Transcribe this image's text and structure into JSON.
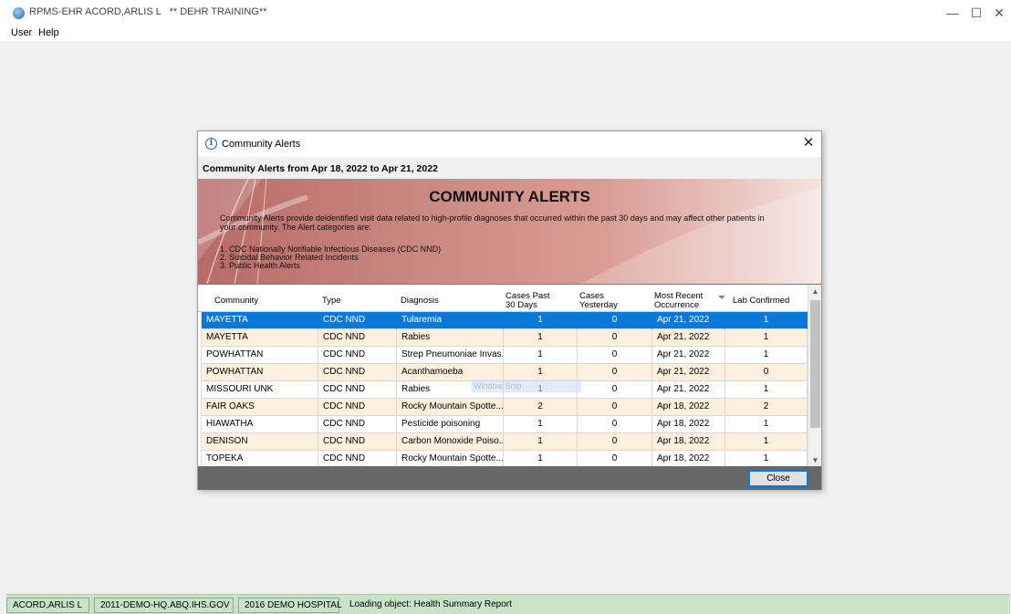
{
  "app": {
    "title": "RPMS-EHR ACORD,ARLIS L   ** DEHR TRAINING**",
    "menu": [
      "User",
      "Help"
    ],
    "window_controls": {
      "minimize": "—",
      "maximize": "☐",
      "close": "✕"
    }
  },
  "dialog": {
    "title": "Community Alerts",
    "close_glyph": "✕",
    "info_glyph": "i",
    "subtitle": "Community Alerts from Apr 18, 2022 to Apr 21, 2022",
    "banner": {
      "heading": "COMMUNITY ALERTS",
      "description": "Community Alerts provide deidentified visit data related to high-profile diagnoses that occurred within the past 30 days and may affect other patients in your community.  The Alert categories are:",
      "categories": [
        "1. CDC Nationally Notifiable Infectious Diseases (CDC NND)",
        "2. Suicidal Behavior Related Incidents",
        "3. Public Health Alerts"
      ]
    },
    "grid": {
      "headers": {
        "community": "Community",
        "type": "Type",
        "diagnosis": "Diagnosis",
        "cases_past_30_line1": "Cases Past",
        "cases_past_30_line2": "30 Days",
        "cases_yesterday_line1": "Cases",
        "cases_yesterday_line2": "Yesterday",
        "most_recent_line1": "Most Recent",
        "most_recent_line2": "Occurrence",
        "lab_confirmed": "Lab Confirmed"
      },
      "rows": [
        {
          "community": "MAYETTA",
          "type": "CDC NND",
          "diagnosis": "Tularemia",
          "cases_30": "1",
          "cases_yesterday": "0",
          "most_recent": "Apr 21, 2022",
          "lab_confirmed": "1",
          "style": "selected"
        },
        {
          "community": "MAYETTA",
          "type": "CDC NND",
          "diagnosis": "Rabies",
          "cases_30": "1",
          "cases_yesterday": "0",
          "most_recent": "Apr 21, 2022",
          "lab_confirmed": "1",
          "style": "alt"
        },
        {
          "community": "POWHATTAN",
          "type": "CDC NND",
          "diagnosis": "Strep Pneumoniae Invas...",
          "cases_30": "1",
          "cases_yesterday": "0",
          "most_recent": "Apr 21, 2022",
          "lab_confirmed": "1",
          "style": "plain"
        },
        {
          "community": "POWHATTAN",
          "type": "CDC NND",
          "diagnosis": "Acanthamoeba",
          "cases_30": "1",
          "cases_yesterday": "0",
          "most_recent": "Apr 21, 2022",
          "lab_confirmed": "0",
          "style": "alt"
        },
        {
          "community": "MISSOURI UNK",
          "type": "CDC NND",
          "diagnosis": "Rabies",
          "cases_30": "1",
          "cases_yesterday": "0",
          "most_recent": "Apr 21, 2022",
          "lab_confirmed": "1",
          "style": "plain"
        },
        {
          "community": "FAIR OAKS",
          "type": "CDC NND",
          "diagnosis": "Rocky Mountain Spotte...",
          "cases_30": "2",
          "cases_yesterday": "0",
          "most_recent": "Apr 18, 2022",
          "lab_confirmed": "2",
          "style": "alt"
        },
        {
          "community": "HIAWATHA",
          "type": "CDC NND",
          "diagnosis": "Pesticide poisoning",
          "cases_30": "1",
          "cases_yesterday": "0",
          "most_recent": "Apr 18, 2022",
          "lab_confirmed": "1",
          "style": "plain"
        },
        {
          "community": "DENISON",
          "type": "CDC NND",
          "diagnosis": "Carbon Monoxide Poiso...",
          "cases_30": "1",
          "cases_yesterday": "0",
          "most_recent": "Apr 18, 2022",
          "lab_confirmed": "1",
          "style": "alt"
        },
        {
          "community": "TOPEKA",
          "type": "CDC NND",
          "diagnosis": "Rocky Mountain Spotte...",
          "cases_30": "1",
          "cases_yesterday": "0",
          "most_recent": "Apr 18, 2022",
          "lab_confirmed": "1",
          "style": "plain"
        }
      ],
      "scroll_up": "▲",
      "scroll_down": "▼"
    },
    "overlay_text": "Window Snip",
    "close_button": "Close"
  },
  "statusbar": {
    "user": "ACORD,ARLIS L",
    "server": "2011-DEMO-HQ.ABQ.IHS.GOV",
    "facility": "2016 DEMO HOSPITAL",
    "message": "Loading object: Health Summary Report"
  },
  "colors": {
    "selected_row": "#0a78d7",
    "alt_row": "#fdf0dd",
    "banner_start": "#b86a66",
    "status_bg": "#c9e3c9"
  }
}
